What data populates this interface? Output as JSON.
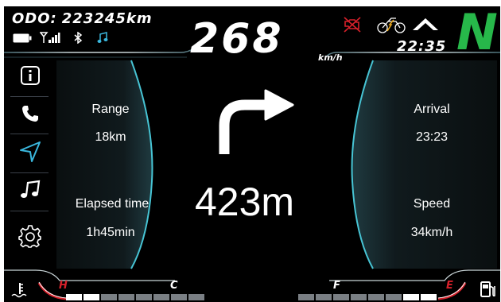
{
  "odometer": {
    "label": "ODO:",
    "value": "223245km"
  },
  "speedometer": {
    "value": "268",
    "unit": "km/h"
  },
  "clock": "22:35",
  "gear": "N",
  "colors": {
    "gear": "#27b84a",
    "warning": "#d6202a",
    "accent": "#3ab7dd",
    "panel": "#10191c"
  },
  "status_icons": [
    "battery-icon",
    "signal-icon",
    "bluetooth-icon",
    "music-note-icon"
  ],
  "warning_icons": [
    "engine-warning-icon",
    "motorcycle-icon",
    "high-beam-icon"
  ],
  "menu": [
    {
      "name": "info",
      "icon": "info-icon",
      "active": false
    },
    {
      "name": "phone",
      "icon": "phone-icon",
      "active": false
    },
    {
      "name": "navigation",
      "icon": "navigation-icon",
      "active": true
    },
    {
      "name": "music",
      "icon": "music-icon",
      "active": false
    },
    {
      "name": "settings",
      "icon": "settings-icon",
      "active": false
    }
  ],
  "navigation": {
    "direction": "turn-right",
    "distance": "423m",
    "range": {
      "label": "Range",
      "value": "18km"
    },
    "elapsed": {
      "label": "Elapsed time",
      "value": "1h45min"
    },
    "arrival": {
      "label": "Arrival",
      "value": "23:23"
    },
    "speed": {
      "label": "Speed",
      "value": "34km/h"
    }
  },
  "gauges": {
    "temperature": {
      "high_label": "H",
      "low_label": "C",
      "level": 0.25
    },
    "fuel": {
      "full_label": "F",
      "empty_label": "E",
      "level": 0.25
    }
  }
}
